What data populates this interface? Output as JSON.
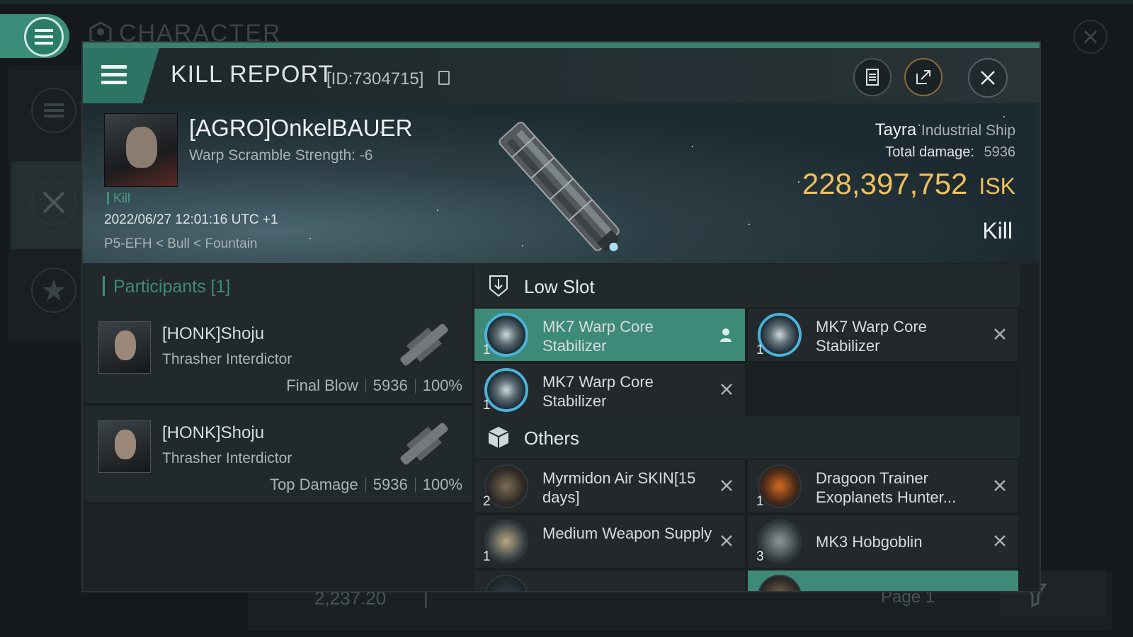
{
  "background": {
    "title": "CHARACTER",
    "bottom_value": "2,237.20",
    "bottom_separator": "|",
    "page_label": "Page 1"
  },
  "header": {
    "title": "KILL REPORT",
    "report_id": "[ID:7304715]",
    "buttons": {
      "report_icon": "clipboard-icon",
      "share_icon": "share-icon",
      "close_icon": "close-icon"
    }
  },
  "victim": {
    "name": "[AGRO]OnkelBAUER",
    "subtitle": "Warp Scramble Strength: -6",
    "tag": "Kill",
    "datetime": "2022/06/27 12:01:16 UTC +1",
    "location": "P5-EFH < Bull < Fountain",
    "ship_name": "Tayra",
    "ship_class": "Industrial Ship",
    "total_damage_label": "Total damage:",
    "total_damage": "5936",
    "isk_value": "228,397,752",
    "isk_unit": "ISK",
    "result": "Kill"
  },
  "participants": {
    "title": "Participants [1]",
    "rows": [
      {
        "name": "[HONK]Shoju",
        "ship": "Thrasher Interdictor",
        "role": "Final Blow",
        "damage": "5936",
        "percent": "100%"
      },
      {
        "name": "[HONK]Shoju",
        "ship": "Thrasher Interdictor",
        "role": "Top Damage",
        "damage": "5936",
        "percent": "100%"
      }
    ]
  },
  "sections": {
    "low_slot": {
      "label": "Low Slot",
      "icon": "low-slot-icon",
      "items": [
        {
          "name": "MK7 Warp Core Stabilizer",
          "qty": "1",
          "status": "dropped",
          "flag_icon": "person-icon"
        },
        {
          "name": "MK7 Warp Core Stabilizer",
          "qty": "1",
          "status": "destroyed",
          "flag_icon": "x-icon"
        },
        {
          "name": "MK7 Warp Core Stabilizer",
          "qty": "1",
          "status": "destroyed",
          "flag_icon": "x-icon"
        }
      ]
    },
    "others": {
      "label": "Others",
      "icon": "cube-icon",
      "items": [
        {
          "name": "Myrmidon Air SKIN[15 days]",
          "qty": "2",
          "status": "destroyed",
          "flag_icon": "x-icon"
        },
        {
          "name": "Dragoon Trainer Exoplanets Hunter...",
          "qty": "1",
          "status": "destroyed",
          "flag_icon": "x-icon"
        },
        {
          "name": "Medium Weapon Supply",
          "qty": "1",
          "status": "destroyed",
          "flag_icon": "x-icon"
        },
        {
          "name": "MK3 Hobgoblin",
          "qty": "3",
          "status": "destroyed",
          "flag_icon": "x-icon"
        }
      ]
    }
  },
  "colors": {
    "accent": "#3e8a78",
    "isk": "#efc05a",
    "stabilizer_ring": "#4bb2d8"
  }
}
